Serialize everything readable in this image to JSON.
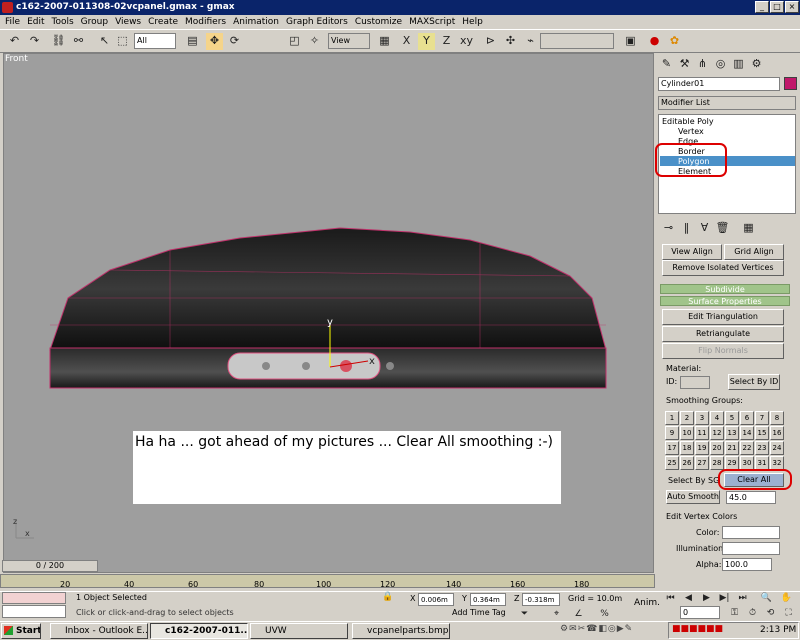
{
  "window": {
    "title": "c162-2007-011308-02vcpanel.gmax - gmax",
    "min": "_",
    "max": "□",
    "close": "×"
  },
  "menu": [
    "File",
    "Edit",
    "Tools",
    "Group",
    "Views",
    "Create",
    "Modifiers",
    "Animation",
    "Graph Editors",
    "Customize",
    "MAXScript",
    "Help"
  ],
  "toolbar": {
    "selection_filter": "All",
    "ref_coord": "View",
    "named_sel": ""
  },
  "viewport": {
    "label": "Front",
    "axis_y": "y",
    "axis_x": "x",
    "gizmo_x": "x",
    "gizmo_z": "z"
  },
  "note": {
    "text": "Ha ha ... got ahead of my pictures ... Clear All smoothing :-)"
  },
  "panel": {
    "object_name": "Cylinder01",
    "modifier_list": "Modifier List",
    "stack": [
      {
        "label": "Editable Poly",
        "level": 0
      },
      {
        "label": "Vertex",
        "level": 1
      },
      {
        "label": "Edge",
        "level": 1
      },
      {
        "label": "Border",
        "level": 1
      },
      {
        "label": "Polygon",
        "level": 1
      },
      {
        "label": "Element",
        "level": 1
      }
    ],
    "view_align": "View Align",
    "grid_align": "Grid Align",
    "remove_isolated": "Remove Isolated Vertices",
    "subdivide": "Subdivide",
    "surface_props": "Surface Properties",
    "edit_tri": "Edit Triangulation",
    "retriangulate": "Retriangulate",
    "flip_normals": "Flip Normals",
    "material": "Material:",
    "id_label": "ID:",
    "select_by_id": "Select By ID",
    "smoothing_groups": "Smoothing Groups:",
    "sg_numbers": [
      "1",
      "2",
      "3",
      "4",
      "5",
      "6",
      "7",
      "8",
      "9",
      "10",
      "11",
      "12",
      "13",
      "14",
      "15",
      "16",
      "17",
      "18",
      "19",
      "20",
      "21",
      "22",
      "23",
      "24",
      "25",
      "26",
      "27",
      "28",
      "29",
      "30",
      "31",
      "32"
    ],
    "select_by_sg": "Select By SG",
    "clear_all": "Clear All",
    "auto_smooth": "Auto Smooth",
    "auto_smooth_value": "45.0",
    "edit_vertex_colors": "Edit Vertex Colors",
    "color": "Color:",
    "illumination": "Illumination:",
    "alpha": "Alpha:",
    "alpha_value": "100.0"
  },
  "timeline": {
    "frame": "0 / 200",
    "ticks": [
      "20",
      "40",
      "60",
      "80",
      "100",
      "120",
      "140",
      "160",
      "180"
    ]
  },
  "status": {
    "selected": "1 Object Selected",
    "prompt": "Click or click-and-drag to select objects",
    "x_label": "X",
    "x_value": "0.006m",
    "y_label": "Y",
    "y_value": "0.364m",
    "z_label": "Z",
    "z_value": "-0.318m",
    "grid": "Grid = 10.0m",
    "add_time_tag": "Add Time Tag",
    "anim": "Anim.",
    "frame_field": "0"
  },
  "taskbar": {
    "start": "Start",
    "tasks": [
      "Inbox - Outlook E...",
      "c162-2007-011...",
      "UVW",
      "vcpanelparts.bmp ..."
    ],
    "clock": "2:13 PM"
  },
  "colors": {
    "titlebar": "#0a246a",
    "selection": "#4a90c8",
    "rollout": "#a0c48a",
    "highlight_circle": "#dd0000",
    "object_swatch": "#c0186a"
  }
}
